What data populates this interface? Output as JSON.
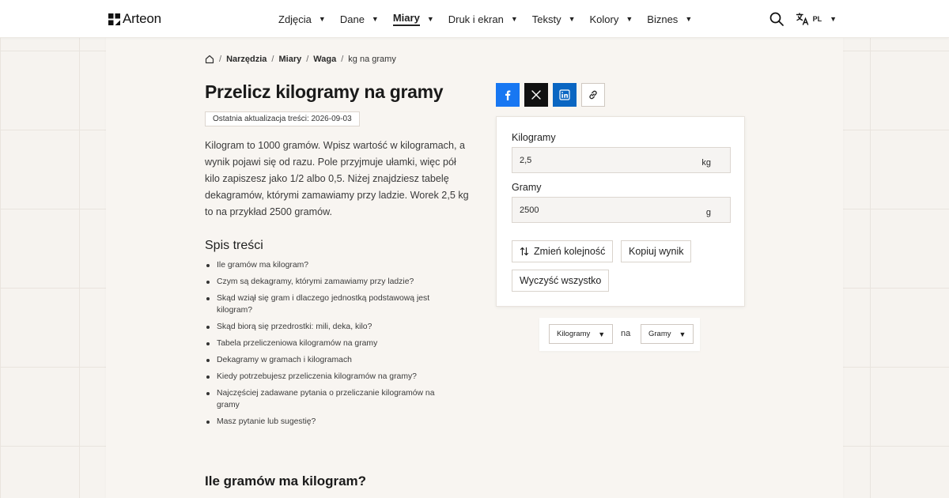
{
  "brand": {
    "name": "Arteon"
  },
  "nav": [
    {
      "label": "Zdjęcia",
      "active": false
    },
    {
      "label": "Dane",
      "active": false
    },
    {
      "label": "Miary",
      "active": true
    },
    {
      "label": "Druk i ekran",
      "active": false
    },
    {
      "label": "Teksty",
      "active": false
    },
    {
      "label": "Kolory",
      "active": false
    },
    {
      "label": "Biznes",
      "active": false
    }
  ],
  "header": {
    "lang": "PL"
  },
  "breadcrumb": {
    "items": [
      "Narzędzia",
      "Miary",
      "Waga"
    ],
    "current": "kg na gramy"
  },
  "page": {
    "title": "Przelicz kilogramy na gramy",
    "updated": "Ostatnia aktualizacja treści: 2026-09-03",
    "intro": "Kilogram to 1000 gramów. Wpisz wartość w kilogramach, a wynik pojawi się od razu. Pole przyjmuje ułamki, więc pół kilo zapiszesz jako 1/2 albo 0,5. Niżej znajdziesz tabelę dekagramów, którymi zamawiamy przy ladzie. Worek 2,5 kg to na przykład 2500 gramów.",
    "toc_title": "Spis treści",
    "toc": [
      "Ile gramów ma kilogram?",
      "Czym są dekagramy, którymi zamawiamy przy ladzie?",
      "Skąd wziął się gram i dlaczego jednostką podstawową jest kilogram?",
      "Skąd biorą się przedrostki: mili, deka, kilo?",
      "Tabela przeliczeniowa kilogramów na gramy",
      "Dekagramy w gramach i kilogramach",
      "Kiedy potrzebujesz przeliczenia kilogramów na gramy?",
      "Najczęściej zadawane pytania o przeliczanie kilogramów na gramy",
      "Masz pytanie lub sugestię?"
    ],
    "section_heading": "Ile gramów ma kilogram?"
  },
  "converter": {
    "from": {
      "label": "Kilogramy",
      "value": "2,5",
      "unit": "kg"
    },
    "to": {
      "label": "Gramy",
      "value": "2500",
      "unit": "g"
    },
    "swap_label": "Zmień kolejność",
    "copy_label": "Kopiuj wynik",
    "clear_label": "Wyczyść wszystko"
  },
  "unit_picker": {
    "from": "Kilogramy",
    "connector": "na",
    "to": "Gramy"
  },
  "colors": {
    "facebook": "#1877f2",
    "x": "#111111",
    "linkedin": "#0a66c2"
  }
}
